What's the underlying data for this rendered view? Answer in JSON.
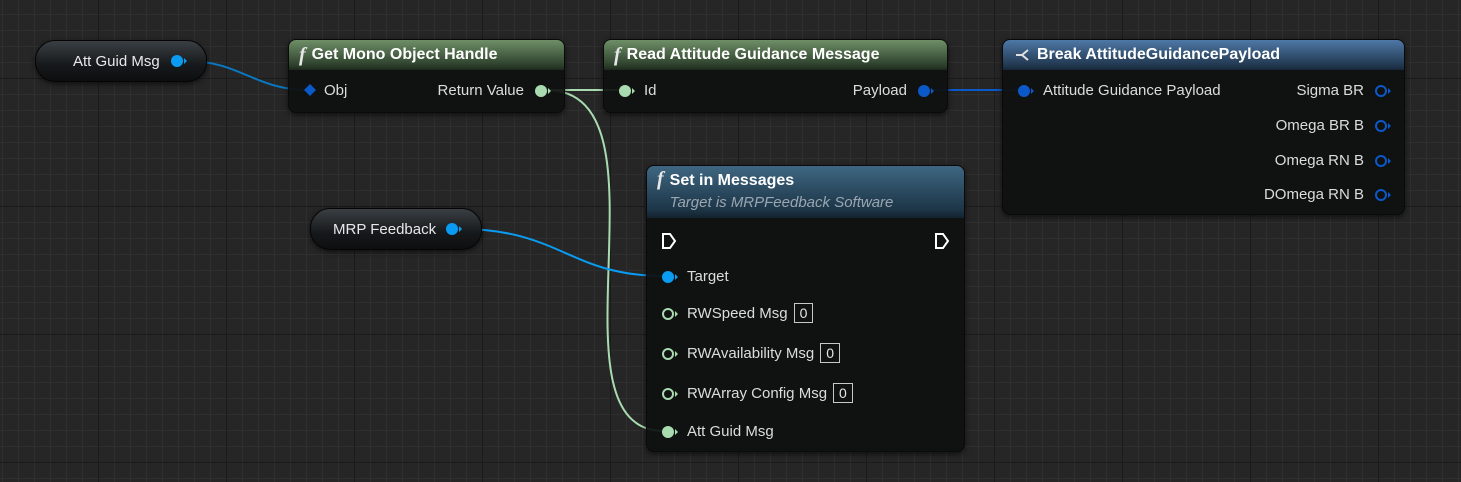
{
  "colors": {
    "object_pin": "#0a9cf2",
    "struct_pin": "#0b58c9",
    "handle_pin": "#a8dcb0",
    "exec_pin": "#ffffff",
    "wire_object": "#0a78c0",
    "wire_handle": "#a8dcb0"
  },
  "variables": {
    "att_guid_msg": {
      "label": "Att Guid Msg",
      "icon": "object-pin-icon"
    },
    "mrp_feedback": {
      "label": "MRP Feedback",
      "icon": "object-pin-icon"
    }
  },
  "nodes": {
    "get_mono_object_handle": {
      "title": "Get Mono Object Handle",
      "icon": "function-icon",
      "inputs": [
        "Obj"
      ],
      "outputs": [
        "Return Value"
      ]
    },
    "read_attitude_guidance_message": {
      "title": "Read Attitude Guidance Message",
      "icon": "function-icon",
      "inputs": [
        "Id"
      ],
      "outputs": [
        "Payload"
      ]
    },
    "break_payload": {
      "title": "Break AttitudeGuidancePayload",
      "icon": "break-struct-icon",
      "inputs": [
        "Attitude Guidance Payload"
      ],
      "outputs": [
        "Sigma BR",
        "Omega BR B",
        "Omega RN B",
        "DOmega RN B"
      ]
    },
    "set_in_messages": {
      "title": "Set in Messages",
      "subtitle": "Target is MRPFeedback Software",
      "icon": "function-icon",
      "inputs": [
        {
          "label": "Target"
        },
        {
          "label": "RWSpeed Msg",
          "default": "0"
        },
        {
          "label": "RWAvailability Msg",
          "default": "0"
        },
        {
          "label": "RWArray Config Msg",
          "default": "0"
        },
        {
          "label": "Att Guid Msg"
        }
      ]
    }
  }
}
